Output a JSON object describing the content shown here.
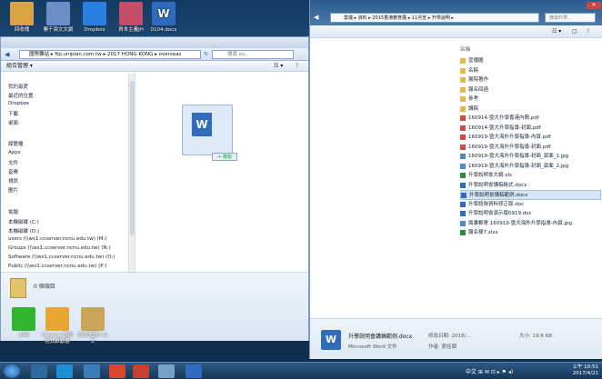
{
  "desktop": {
    "icons": [
      {
        "label": "回收桶",
        "color": "#d9a441"
      },
      {
        "label": "勝于兩文文劇",
        "color": "#6a8fc7"
      },
      {
        "label": "Dropbox",
        "color": "#2a7de1"
      },
      {
        "label": "資本主義JH",
        "color": "#c44d6a"
      },
      {
        "label": "0104.docx",
        "color": "#2f6bbf"
      }
    ],
    "bottom_icons": [
      {
        "label": "LINE",
        "color": "#2fb52f"
      },
      {
        "label": "Chrome 應用程式啟動器",
        "color": "#e8a530"
      },
      {
        "label": "訪日美國人公文",
        "color": "#caa55a"
      }
    ]
  },
  "left_window": {
    "address": "國際轉站 ▸ ftp.uniplan.com.tw ▸ 2017 HONG KONG ▸ overseas",
    "search_placeholder": "搜尋 ov...",
    "toolbar_label": "組合管理 ▾",
    "nav": {
      "favorites_header": "我的最愛",
      "favorites": [
        "最近的位置",
        "Dropbox",
        "下載",
        "桌面"
      ],
      "libraries_header": "媒體櫃",
      "libraries": [
        "Apps",
        "文件",
        "音樂",
        "視訊",
        "圖片"
      ],
      "computer_header": "電腦",
      "drives": [
        "本機磁碟 (C:)",
        "本機磁碟 (D:)",
        "users (\\\\ws1.ccserver.ncnu.edu.tw) (M:)",
        "Groups (\\\\ws1.ccserver.ncnu.edu.tw) (N:)",
        "Software (\\\\ws1.ccserver.ncnu.edu.tw) (O:)",
        "Public (\\\\ws1.ccserver.ncnu.edu.tw) (P:)"
      ]
    },
    "drag_badge": "+ 複製",
    "status_text": "0 個項目"
  },
  "right_window": {
    "address": "雲端 ▸ 資料 ▸ 2015香港教育展 ▸ 11月宣 ▸ 升學說明 ▸",
    "search_placeholder": "搜尋升學...",
    "column_header": "名稱",
    "files": [
      {
        "name": "宣傳圖",
        "type": "folder"
      },
      {
        "name": "名稿",
        "type": "folder"
      },
      {
        "name": "展院著作",
        "type": "folder"
      },
      {
        "name": "報名回函",
        "type": "folder"
      },
      {
        "name": "參考",
        "type": "folder"
      },
      {
        "name": "講稿",
        "type": "folder"
      },
      {
        "name": "160914-暨大升學香港內簡.pdf",
        "type": "pdf"
      },
      {
        "name": "160914-暨大升學指導-封面.pdf",
        "type": "pdf"
      },
      {
        "name": "160919-暨大海外升學指導-內頁.pdf",
        "type": "pdf"
      },
      {
        "name": "160919-暨大海外升學指導-封面.pdf",
        "type": "pdf"
      },
      {
        "name": "160919-暨大海外升學指導-封面_頁面_1.jpg",
        "type": "img"
      },
      {
        "name": "160919-暨大海外升學指導-封面_頁面_2.jpg",
        "type": "img"
      },
      {
        "name": "升學說明會大綱.xls",
        "type": "xls"
      },
      {
        "name": "升學說明會講稿格式.docx",
        "type": "doc"
      },
      {
        "name": "升學說明會講稿範例.docx",
        "type": "doc",
        "selected": true
      },
      {
        "name": "升學諮詢資料修正版.doc",
        "type": "doc"
      },
      {
        "name": "升學說明會演示版0919.doc",
        "type": "doc"
      },
      {
        "name": "面書郵寄 160919-暨大海外升學指導-內頁.jpg",
        "type": "img"
      },
      {
        "name": "報名樣7.xlsx",
        "type": "xls"
      }
    ],
    "detail": {
      "filename": "升學說明會講稿範例.docx",
      "date_label": "修改日期: 2016/...",
      "type": "Microsoft Word 文件",
      "size": "大小: 19.6 KB",
      "author": "作者: 劉佳頤",
      "icon_letter": "W"
    }
  },
  "taskbar": {
    "time": "上午 10:51",
    "date": "2017/4/21",
    "ime": "中文 ⊞ ✉ ⊡ ▸ ⚑ ◂)"
  },
  "colors": {
    "explorer_accent": "#7a9cc4",
    "selected_row": "#d7e6f7",
    "close_button": "#c9463d"
  }
}
